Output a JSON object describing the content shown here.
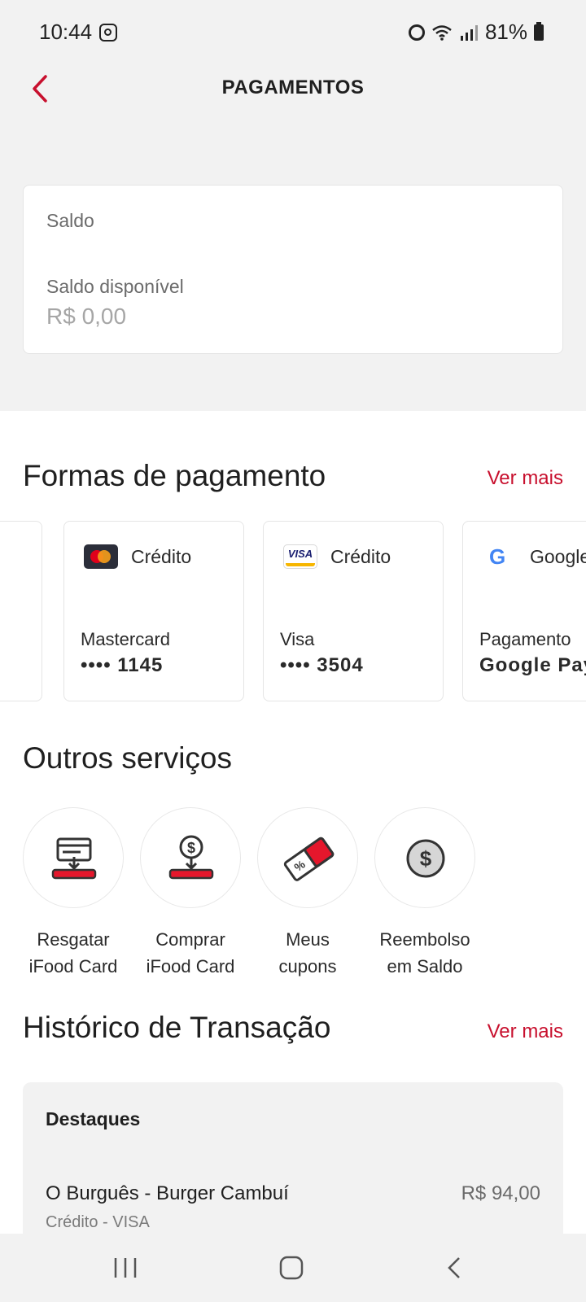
{
  "status_bar": {
    "time": "10:44",
    "battery": "81%"
  },
  "header": {
    "title": "PAGAMENTOS"
  },
  "balance": {
    "heading": "Saldo",
    "label": "Saldo disponível",
    "value": "R$ 0,00"
  },
  "payment_methods": {
    "title": "Formas de pagamento",
    "see_more": "Ver mais",
    "cards": [
      {
        "type": "Crédito",
        "brand": "Mastercard",
        "number": "•••• 1145",
        "icon": "mastercard-icon"
      },
      {
        "type": "Crédito",
        "brand": "Visa",
        "number": "•••• 3504",
        "icon": "visa-icon",
        "logo_text": "VISA"
      },
      {
        "type": "Google Pay",
        "brand": "Pagamento",
        "number": "Google Pay",
        "icon": "google-icon",
        "logo_text": "G"
      }
    ]
  },
  "services": {
    "title": "Outros serviços",
    "items": [
      {
        "line1": "Resgatar",
        "line2": "iFood Card",
        "icon": "redeem-card-icon"
      },
      {
        "line1": "Comprar",
        "line2": "iFood Card",
        "icon": "buy-card-icon"
      },
      {
        "line1": "Meus",
        "line2": "cupons",
        "icon": "coupon-icon"
      },
      {
        "line1": "Reembolso",
        "line2": "em Saldo",
        "icon": "refund-icon"
      }
    ]
  },
  "transactions": {
    "title": "Histórico de Transação",
    "see_more": "Ver mais",
    "highlights": "Destaques",
    "items": [
      {
        "name": "O Burguês - Burger Cambuí",
        "amount": "R$ 94,00",
        "method": "Crédito - VISA"
      }
    ]
  },
  "colors": {
    "accent": "#c8102e",
    "background_gray": "#f2f2f2"
  }
}
